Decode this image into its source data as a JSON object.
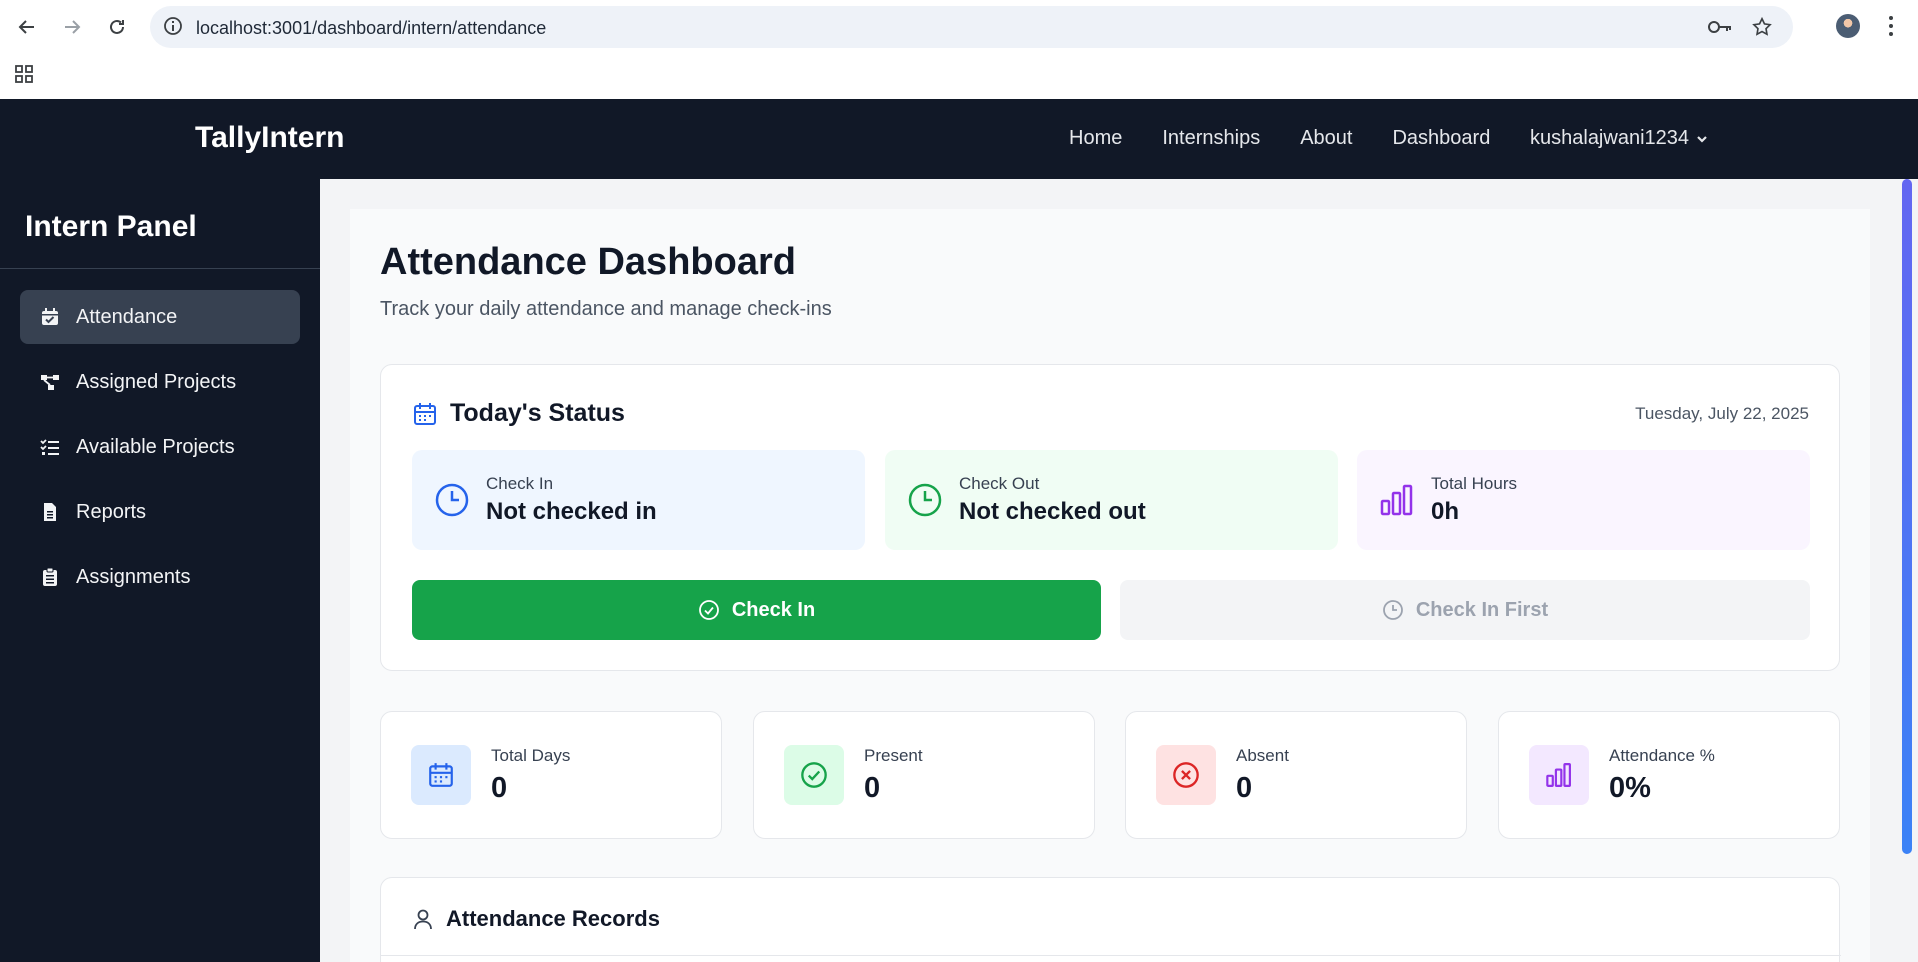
{
  "browser": {
    "url": "localhost:3001/dashboard/intern/attendance"
  },
  "header": {
    "brand": "TallyIntern",
    "nav": [
      "Home",
      "Internships",
      "About",
      "Dashboard"
    ],
    "user": "kushalajwani1234"
  },
  "sidebar": {
    "title": "Intern Panel",
    "items": [
      {
        "label": "Attendance",
        "icon": "calendar-check-icon",
        "active": true
      },
      {
        "label": "Assigned Projects",
        "icon": "project-diagram-icon"
      },
      {
        "label": "Available Projects",
        "icon": "list-check-icon"
      },
      {
        "label": "Reports",
        "icon": "file-icon"
      },
      {
        "label": "Assignments",
        "icon": "clipboard-icon"
      }
    ]
  },
  "page": {
    "title": "Attendance Dashboard",
    "subtitle": "Track your daily attendance and manage check-ins"
  },
  "today": {
    "heading": "Today's Status",
    "date": "Tuesday, July 22, 2025",
    "tiles": [
      {
        "label": "Check In",
        "value": "Not checked in",
        "bg": "#eff6ff",
        "color": "#2563eb"
      },
      {
        "label": "Check Out",
        "value": "Not checked out",
        "bg": "#f0fdf4",
        "color": "#16a34a"
      },
      {
        "label": "Total Hours",
        "value": "0h",
        "bg": "#faf5ff",
        "color": "#9333ea"
      }
    ],
    "check_in_button": "Check In",
    "check_out_button": "Check In First"
  },
  "stats": [
    {
      "label": "Total Days",
      "value": "0",
      "bg": "#dbeafe",
      "color": "#2563eb",
      "icon": "calendar-icon"
    },
    {
      "label": "Present",
      "value": "0",
      "bg": "#dcfce7",
      "color": "#16a34a",
      "icon": "check-circle-icon"
    },
    {
      "label": "Absent",
      "value": "0",
      "bg": "#fee2e2",
      "color": "#dc2626",
      "icon": "x-circle-icon"
    },
    {
      "label": "Attendance %",
      "value": "0%",
      "bg": "#f3e8ff",
      "color": "#9333ea",
      "icon": "bar-chart-icon"
    }
  ],
  "records": {
    "heading": "Attendance Records"
  }
}
